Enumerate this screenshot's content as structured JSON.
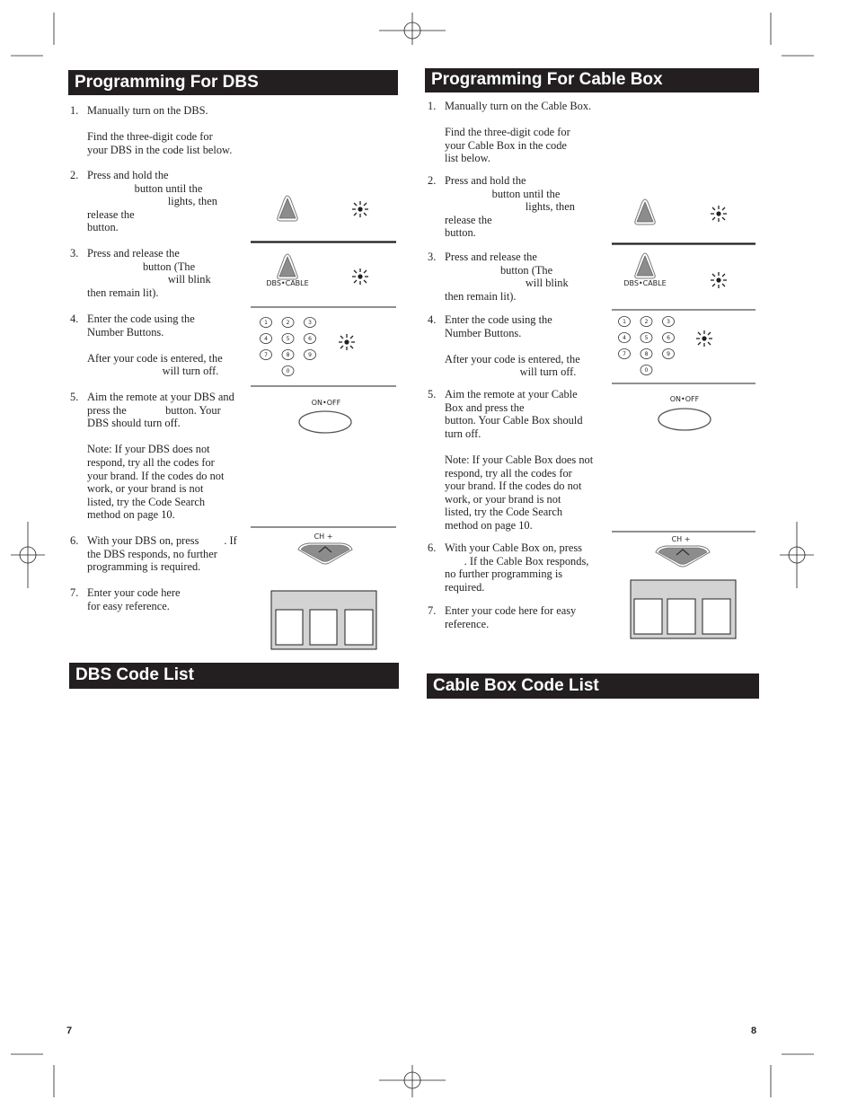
{
  "left": {
    "title": "Programming For DBS",
    "steps": [
      {
        "n": "1.",
        "text": "Manually turn on the DBS.\n\nFind the three-digit code for\nyour DBS in the code list below."
      },
      {
        "n": "2.",
        "text": "Press and hold the\n                 button until the\n                             lights, then\nrelease the\nbutton."
      },
      {
        "n": "3.",
        "text": "Press and release the\n                    button (The\n                             will blink\nthen remain lit)."
      },
      {
        "n": "4.",
        "text": "Enter the code using the\nNumber Buttons.\n\nAfter your code is entered, the\n                           will turn off."
      },
      {
        "n": "5.",
        "text": "Aim the remote at your DBS and\npress the              button. Your\nDBS should turn off.\n\nNote: If your DBS does not\nrespond, try all the codes for\nyour brand. If the codes do not\nwork, or your brand is not\nlisted, try the Code Search\nmethod on page 10."
      },
      {
        "n": "6.",
        "text": "With your DBS on, press         . If\nthe DBS responds, no further\nprogramming is required."
      },
      {
        "n": "7.",
        "text": "Enter your code here\nfor easy reference."
      }
    ],
    "code_list_title": "DBS Code List",
    "page_number": "7"
  },
  "right": {
    "title": "Programming For Cable Box",
    "steps": [
      {
        "n": "1.",
        "text": "Manually turn on the Cable Box.\n\nFind the three-digit code for\nyour Cable Box in the code\nlist below."
      },
      {
        "n": "2.",
        "text": "Press and hold the\n                 button until the\n                             lights, then\nrelease the\nbutton."
      },
      {
        "n": "3.",
        "text": "Press and release the\n                    button (The\n                             will blink\nthen remain lit)."
      },
      {
        "n": "4.",
        "text": "Enter the code using the\nNumber Buttons.\n\nAfter your code is entered, the\n                           will turn off."
      },
      {
        "n": "5.",
        "text": "Aim the remote at your Cable\nBox and press the\nbutton. Your Cable Box should\nturn off.\n\nNote: If your Cable Box does not\nrespond, try all the codes for\nyour brand. If the codes do not\nwork, or your brand is not\nlisted, try the Code Search\nmethod on page 10."
      },
      {
        "n": "6.",
        "text": "With your Cable Box on, press\n       . If the Cable Box responds,\nno further programming is\nrequired."
      },
      {
        "n": "7.",
        "text": "Enter your code here for easy\nreference."
      }
    ],
    "code_list_title": "Cable Box Code List",
    "page_number": "8"
  },
  "remote": {
    "mode_label": "DBS•CABLE",
    "power_label": "ON•OFF",
    "channel_label": "CH +",
    "keys": [
      "1",
      "2",
      "3",
      "4",
      "5",
      "6",
      "7",
      "8",
      "9",
      "0"
    ]
  },
  "colors": {
    "header_bg": "#231f20",
    "button_fill": "#8c8c8c",
    "code_box_bg": "#d3d3d3"
  }
}
